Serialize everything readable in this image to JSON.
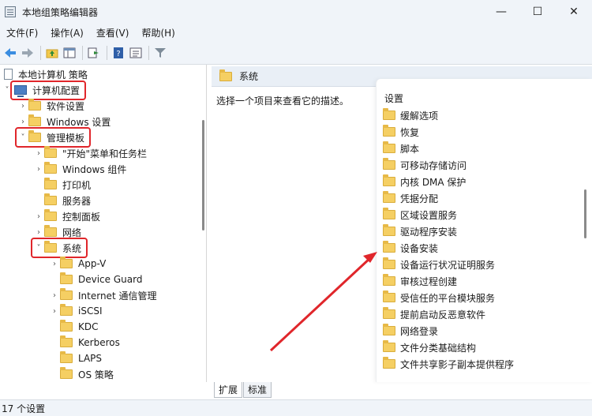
{
  "window": {
    "title": "本地组策略编辑器",
    "minimize": "—",
    "maximize": "☐",
    "close": "✕"
  },
  "menu": [
    "文件(F)",
    "操作(A)",
    "查看(V)",
    "帮助(H)"
  ],
  "toolbar_icons": [
    "back-arrow-icon",
    "forward-arrow-icon",
    "up-folder-icon",
    "show-hide-tree-icon",
    "export-list-icon",
    "help-icon",
    "properties-icon",
    "filter-icon"
  ],
  "tree": {
    "root": "本地计算机 策略",
    "computer_config": "计算机配置",
    "software_settings": "软件设置",
    "windows_settings": "Windows 设置",
    "admin_templates": "管理模板",
    "start_menu": "\"开始\"菜单和任务栏",
    "windows_components": "Windows 组件",
    "printers": "打印机",
    "server": "服务器",
    "control_panel": "控制面板",
    "network": "网络",
    "system": "系统",
    "children": [
      "App-V",
      "Device Guard",
      "Internet 通信管理",
      "iSCSI",
      "KDC",
      "Kerberos",
      "LAPS",
      "OS 策略"
    ]
  },
  "right": {
    "header": "系统",
    "description": "选择一个项目来查看它的描述。",
    "settings_header": "设置",
    "items": [
      "缓解选项",
      "恢复",
      "脚本",
      "可移动存储访问",
      "内核 DMA 保护",
      "凭据分配",
      "区域设置服务",
      "驱动程序安装",
      "设备安装",
      "设备运行状况证明服务",
      "审核过程创建",
      "受信任的平台模块服务",
      "提前启动反恶意软件",
      "网络登录",
      "文件分类基础结构",
      "文件共享影子副本提供程序"
    ]
  },
  "tabs": [
    "扩展",
    "标准"
  ],
  "status": "17 个设置",
  "colors": {
    "highlight": "#e0262b",
    "folder": "#f5cf63",
    "header_bg": "#e9eff6"
  }
}
